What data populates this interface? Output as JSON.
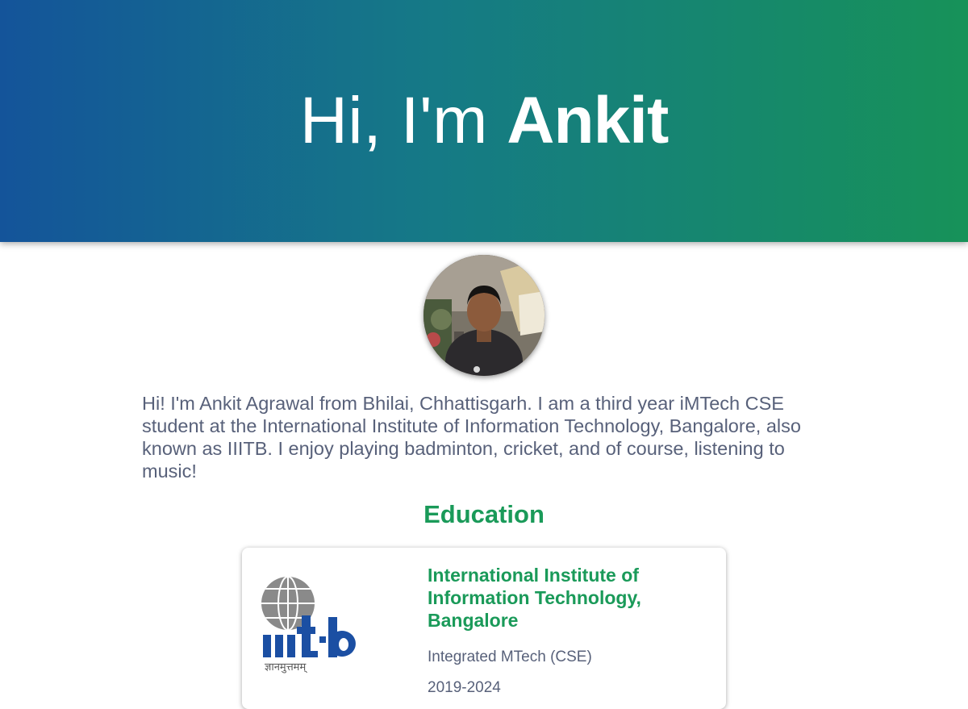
{
  "hero": {
    "greeting": "Hi, I'm",
    "name": "Ankit"
  },
  "profile": {
    "avatar_icon": "profile-photo",
    "bio": "Hi! I'm Ankit Agrawal from Bhilai, Chhattisgarh. I am a third year iMTech CSE student at the International Institute of Information Technology, Bangalore, also known as IIITB. I enjoy playing badminton, cricket, and of course, listening to music!"
  },
  "education": {
    "heading": "Education",
    "items": [
      {
        "school": "International Institute of Information Technology, Bangalore",
        "degree": "Integrated MTech (CSE)",
        "years": "2019-2024",
        "logo": {
          "wordmark": "iiit·b",
          "motto": "ज्ञानमुत्तमम्"
        }
      }
    ]
  },
  "colors": {
    "hero_gradient_start": "#14549a",
    "hero_gradient_end": "#179259",
    "accent_green": "#1a9a59",
    "body_text": "#58617a",
    "logo_blue": "#1b4fa3",
    "logo_gray": "#8a8a8a"
  }
}
